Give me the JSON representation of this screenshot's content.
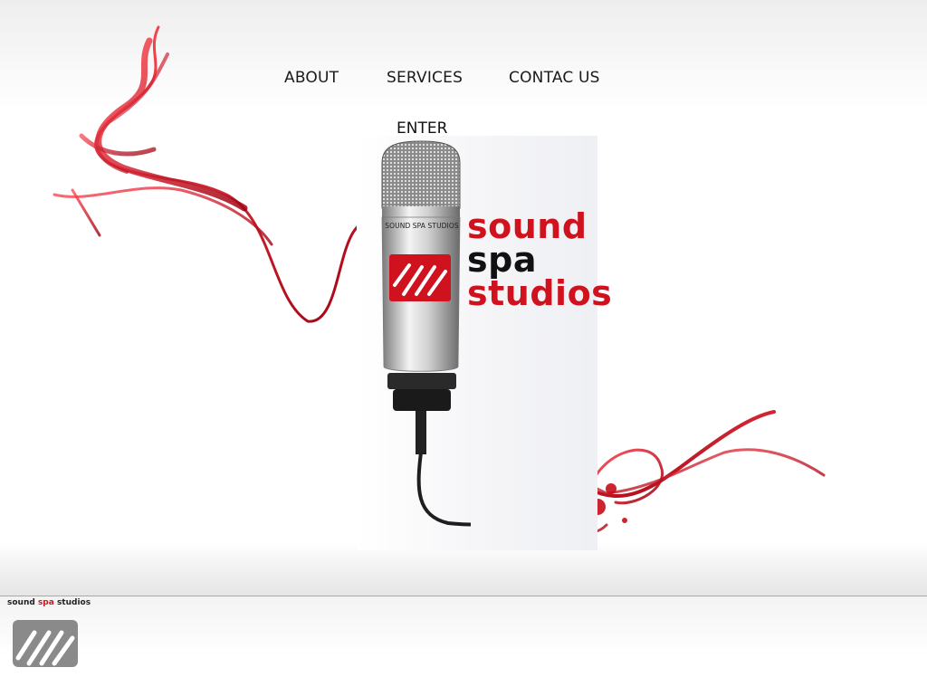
{
  "nav": {
    "about": "ABOUT",
    "services": "SERVICES",
    "contact": "CONTAC US"
  },
  "enter_label": "ENTER",
  "microphone": {
    "label": "SOUND SPA STUDIOS"
  },
  "brand": {
    "word1": "sound",
    "word2": "spa",
    "word3": "studios"
  },
  "footer": {
    "brand_word1": "sound",
    "brand_word2": "spa",
    "brand_word3": "studios"
  },
  "colors": {
    "accent": "#d0121e",
    "text": "#1a1a1a",
    "logo_gray": "#8a8a8a"
  },
  "icons": [
    "microphone",
    "red-ribbon-swirl",
    "studio-logo-mark"
  ]
}
